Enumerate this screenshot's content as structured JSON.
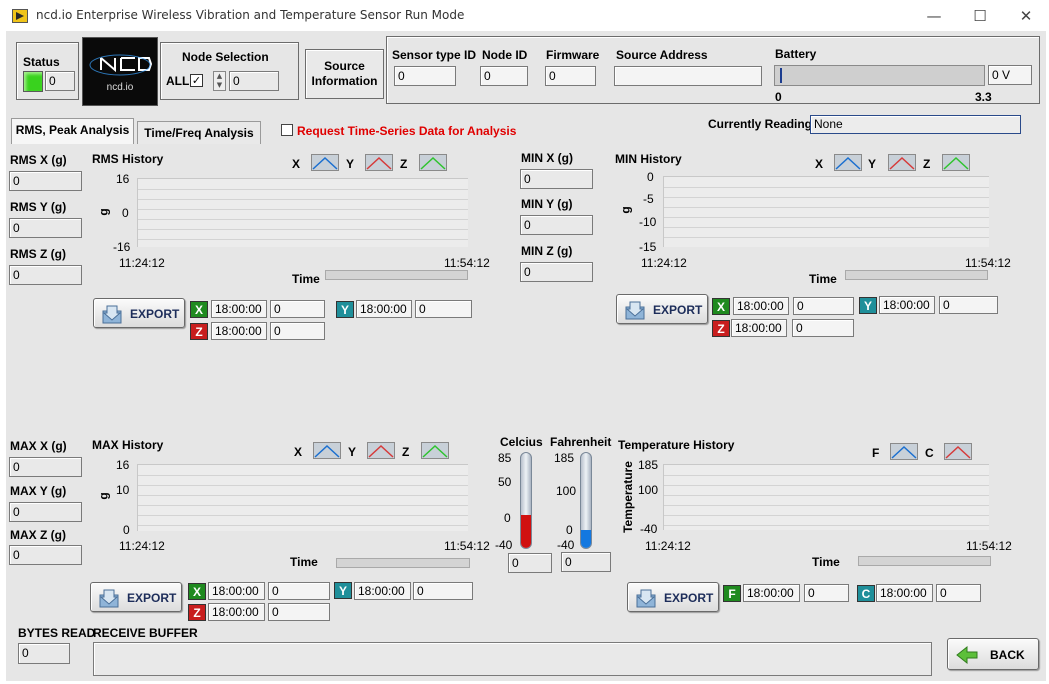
{
  "window": {
    "title": "ncd.io Enterprise Wireless Vibration and Temperature Sensor Run Mode",
    "minimize": "—",
    "maximize": "☐",
    "close": "✕"
  },
  "header": {
    "status_label": "Status",
    "status_value": "0",
    "logo_text": "ncd.io",
    "node_selection_label": "Node Selection",
    "all_label": "ALL",
    "node_value": "0",
    "source_info_line1": "Source",
    "source_info_line2": "Information",
    "sensor_type_label": "Sensor type ID",
    "sensor_type_value": "0",
    "node_id_label": "Node ID",
    "node_id_value": "0",
    "firmware_label": "Firmware",
    "firmware_value": "0",
    "source_address_label": "Source Address",
    "source_address_value": "",
    "battery_label": "Battery",
    "battery_value": "0 V",
    "battery_min": "0",
    "battery_max": "3.3",
    "battery_level": 0
  },
  "tabs": [
    {
      "label": "RMS, Peak Analysis"
    },
    {
      "label": "Time/Freq Analysis"
    }
  ],
  "request_label": "Request Time-Series Data for Analysis",
  "currently_reading_label": "Currently Reading",
  "currently_reading_value": "None",
  "rms": {
    "x_label": "RMS X (g)",
    "x_value": "0",
    "y_label": "RMS Y (g)",
    "y_value": "0",
    "z_label": "RMS Z (g)",
    "z_value": "0",
    "chart_title": "RMS History",
    "ylabel": "g",
    "xlabel": "Time",
    "yticks": [
      "16",
      "0",
      "-16"
    ],
    "xstart": "11:24:12",
    "xend": "11:54:12",
    "legend": [
      "X",
      "Y",
      "Z"
    ],
    "export": "EXPORT",
    "cursors": {
      "x_tag": "X",
      "y_tag": "Y",
      "z_tag": "Z",
      "x_time": "18:00:00",
      "x_val": "0",
      "y_time": "18:00:00",
      "y_val": "0",
      "z_time": "18:00:00",
      "z_val": "0"
    }
  },
  "min": {
    "x_label": "MIN  X (g)",
    "x_value": "0",
    "y_label": "MIN  Y (g)",
    "y_value": "0",
    "z_label": "MIN  Z (g)",
    "z_value": "0",
    "chart_title": "MIN History",
    "ylabel": "g",
    "xlabel": "Time",
    "yticks": [
      "0",
      "-5",
      "-10",
      "-15"
    ],
    "xstart": "11:24:12",
    "xend": "11:54:12",
    "legend": [
      "X",
      "Y",
      "Z"
    ],
    "export": "EXPORT",
    "cursors": {
      "x_tag": "X",
      "y_tag": "Y",
      "z_tag": "Z",
      "x_time": "18:00:00",
      "x_val": "0",
      "y_time": "18:00:00",
      "y_val": "0",
      "z_time": "18:00:00",
      "z_val": "0"
    }
  },
  "max": {
    "x_label": "MAX X (g)",
    "x_value": "0",
    "y_label": "MAX Y (g)",
    "y_value": "0",
    "z_label": "MAX Z (g)",
    "z_value": "0",
    "chart_title": "MAX History",
    "ylabel": "g",
    "xlabel": "Time",
    "yticks": [
      "16",
      "10",
      "0"
    ],
    "xstart": "11:24:12",
    "xend": "11:54:12",
    "legend": [
      "X",
      "Y",
      "Z"
    ],
    "export": "EXPORT",
    "cursors": {
      "x_tag": "X",
      "y_tag": "Y",
      "z_tag": "Z",
      "x_time": "18:00:00",
      "x_val": "0",
      "y_time": "18:00:00",
      "y_val": "0",
      "z_time": "18:00:00",
      "z_val": "0"
    }
  },
  "thermo": {
    "celsius_label": "Celcius",
    "celsius_ticks": [
      "85",
      "50",
      "0",
      "-40"
    ],
    "celsius_value": "0",
    "fahrenheit_label": "Fahrenheit",
    "fahrenheit_ticks": [
      "185",
      "100",
      "0",
      "-40"
    ],
    "fahrenheit_value": "0"
  },
  "temp": {
    "chart_title": "Temperature History",
    "ylabel": "Temperature",
    "xlabel": "Time",
    "yticks": [
      "185",
      "100",
      "-40"
    ],
    "xstart": "11:24:12",
    "xend": "11:54:12",
    "legend": [
      "F",
      "C"
    ],
    "export": "EXPORT",
    "cursors": {
      "f_tag": "F",
      "c_tag": "C",
      "f_time": "18:00:00",
      "f_val": "0",
      "c_time": "18:00:00",
      "c_val": "0"
    }
  },
  "footer": {
    "bytes_label": "BYTES READ",
    "bytes_value": "0",
    "buffer_label": "RECEIVE BUFFER",
    "buffer_value": "",
    "back_label": "BACK"
  },
  "colors": {
    "x_series": "#1a6fd0",
    "y_series": "#d63a3a",
    "z_series": "#2ec42e",
    "status_led": "#39d21e",
    "request_text": "#e00000",
    "x_tag": "#1f8a1f",
    "y_tag": "#1f8f9a",
    "z_tag": "#c81e1e"
  }
}
